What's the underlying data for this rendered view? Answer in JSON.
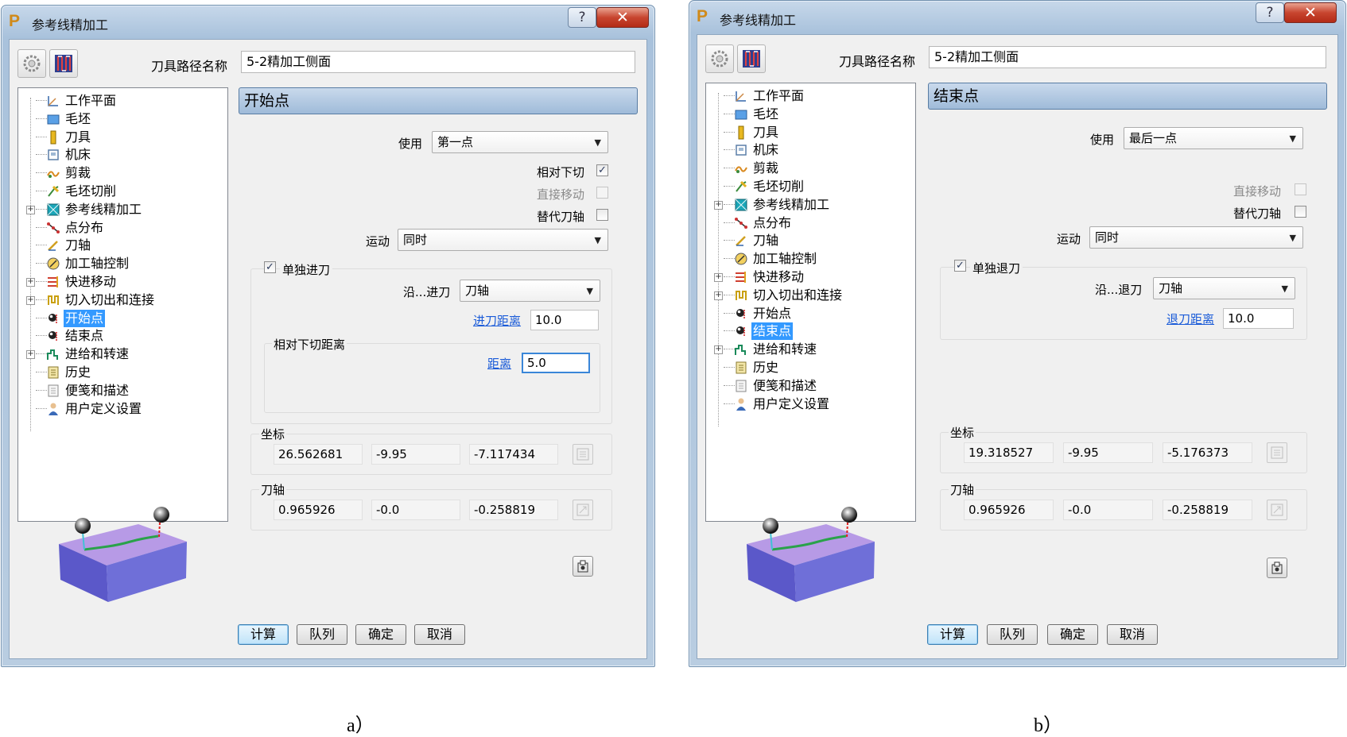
{
  "dialogs": [
    {
      "title": "参考线精加工",
      "help_label": "?",
      "close_label": "✕",
      "toolpath_name_label": "刀具路径名称",
      "toolpath_name_value": "5-2精加工侧面",
      "tree": [
        {
          "label": "工作平面",
          "icon": "workplane-icon",
          "expander": false,
          "selected": false
        },
        {
          "label": "毛坯",
          "icon": "block-icon",
          "expander": false,
          "selected": false
        },
        {
          "label": "刀具",
          "icon": "tool-icon",
          "expander": false,
          "selected": false
        },
        {
          "label": "机床",
          "icon": "machine-icon",
          "expander": false,
          "selected": false
        },
        {
          "label": "剪裁",
          "icon": "limit-icon",
          "expander": false,
          "selected": false
        },
        {
          "label": "毛坯切削",
          "icon": "stock-cut-icon",
          "expander": false,
          "selected": false
        },
        {
          "label": "参考线精加工",
          "icon": "pattern-finish-icon",
          "expander": true,
          "selected": false
        },
        {
          "label": "点分布",
          "icon": "point-distribution-icon",
          "expander": false,
          "selected": false
        },
        {
          "label": "刀轴",
          "icon": "tool-axis-icon",
          "expander": false,
          "selected": false
        },
        {
          "label": "加工轴控制",
          "icon": "axis-control-icon",
          "expander": false,
          "selected": false
        },
        {
          "label": "快进移动",
          "icon": "rapid-move-icon",
          "expander": true,
          "selected": false
        },
        {
          "label": "切入切出和连接",
          "icon": "leads-links-icon",
          "expander": true,
          "selected": false
        },
        {
          "label": "开始点",
          "icon": "start-point-icon",
          "expander": false,
          "selected": true
        },
        {
          "label": "结束点",
          "icon": "end-point-icon",
          "expander": false,
          "selected": false
        },
        {
          "label": "进给和转速",
          "icon": "feeds-speeds-icon",
          "expander": true,
          "selected": false
        },
        {
          "label": "历史",
          "icon": "history-icon",
          "expander": false,
          "selected": false
        },
        {
          "label": "便笺和描述",
          "icon": "notes-icon",
          "expander": false,
          "selected": false
        },
        {
          "label": "用户定义设置",
          "icon": "user-settings-icon",
          "expander": false,
          "selected": false
        }
      ],
      "section_title": "开始点",
      "use_label": "使用",
      "use_value": "第一点",
      "checks": [
        {
          "label": "相对下切",
          "checked": true,
          "disabled": false
        },
        {
          "label": "直接移动",
          "checked": false,
          "disabled": true
        },
        {
          "label": "替代刀轴",
          "checked": false,
          "disabled": false
        }
      ],
      "motion_label": "运动",
      "motion_value": "同时",
      "separate_label": "单独进刀",
      "separate_checked": true,
      "along_label": "沿...进刀",
      "along_value": "刀轴",
      "distance_link": "进刀距离",
      "distance_value": "10.0",
      "relative_group_label": "相对下切距离",
      "relative_distance_link": "距离",
      "relative_distance_value": "5.0",
      "coord_label": "坐标",
      "coords": [
        "26.562681",
        "-9.95",
        "-7.117434"
      ],
      "axis_label": "刀轴",
      "axis": [
        "0.965926",
        "-0.0",
        "-0.258819"
      ],
      "buttons": {
        "calculate": "计算",
        "queue": "队列",
        "ok": "确定",
        "cancel": "取消"
      }
    },
    {
      "title": "参考线精加工",
      "help_label": "?",
      "close_label": "✕",
      "toolpath_name_label": "刀具路径名称",
      "toolpath_name_value": "5-2精加工侧面",
      "tree": [
        {
          "label": "工作平面",
          "icon": "workplane-icon",
          "expander": false,
          "selected": false
        },
        {
          "label": "毛坯",
          "icon": "block-icon",
          "expander": false,
          "selected": false
        },
        {
          "label": "刀具",
          "icon": "tool-icon",
          "expander": false,
          "selected": false
        },
        {
          "label": "机床",
          "icon": "machine-icon",
          "expander": false,
          "selected": false
        },
        {
          "label": "剪裁",
          "icon": "limit-icon",
          "expander": false,
          "selected": false
        },
        {
          "label": "毛坯切削",
          "icon": "stock-cut-icon",
          "expander": false,
          "selected": false
        },
        {
          "label": "参考线精加工",
          "icon": "pattern-finish-icon",
          "expander": true,
          "selected": false
        },
        {
          "label": "点分布",
          "icon": "point-distribution-icon",
          "expander": false,
          "selected": false
        },
        {
          "label": "刀轴",
          "icon": "tool-axis-icon",
          "expander": false,
          "selected": false
        },
        {
          "label": "加工轴控制",
          "icon": "axis-control-icon",
          "expander": false,
          "selected": false
        },
        {
          "label": "快进移动",
          "icon": "rapid-move-icon",
          "expander": true,
          "selected": false
        },
        {
          "label": "切入切出和连接",
          "icon": "leads-links-icon",
          "expander": true,
          "selected": false
        },
        {
          "label": "开始点",
          "icon": "start-point-icon",
          "expander": false,
          "selected": false
        },
        {
          "label": "结束点",
          "icon": "end-point-icon",
          "expander": false,
          "selected": true
        },
        {
          "label": "进给和转速",
          "icon": "feeds-speeds-icon",
          "expander": true,
          "selected": false
        },
        {
          "label": "历史",
          "icon": "history-icon",
          "expander": false,
          "selected": false
        },
        {
          "label": "便笺和描述",
          "icon": "notes-icon",
          "expander": false,
          "selected": false
        },
        {
          "label": "用户定义设置",
          "icon": "user-settings-icon",
          "expander": false,
          "selected": false
        }
      ],
      "section_title": "结束点",
      "use_label": "使用",
      "use_value": "最后一点",
      "checks": [
        {
          "label": "直接移动",
          "checked": false,
          "disabled": true
        },
        {
          "label": "替代刀轴",
          "checked": false,
          "disabled": false
        }
      ],
      "motion_label": "运动",
      "motion_value": "同时",
      "separate_label": "单独退刀",
      "separate_checked": true,
      "along_label": "沿...退刀",
      "along_value": "刀轴",
      "distance_link": "退刀距离",
      "distance_value": "10.0",
      "coord_label": "坐标",
      "coords": [
        "19.318527",
        "-9.95",
        "-5.176373"
      ],
      "axis_label": "刀轴",
      "axis": [
        "0.965926",
        "-0.0",
        "-0.258819"
      ],
      "buttons": {
        "calculate": "计算",
        "queue": "队列",
        "ok": "确定",
        "cancel": "取消"
      }
    }
  ],
  "captions": [
    "a）",
    "b）"
  ],
  "colors": {
    "block_top": "#b79ae6",
    "block_side": "#6a5fcf",
    "path": "#2aa24a",
    "selection": "#3399ff",
    "link": "#1a5bd8"
  }
}
